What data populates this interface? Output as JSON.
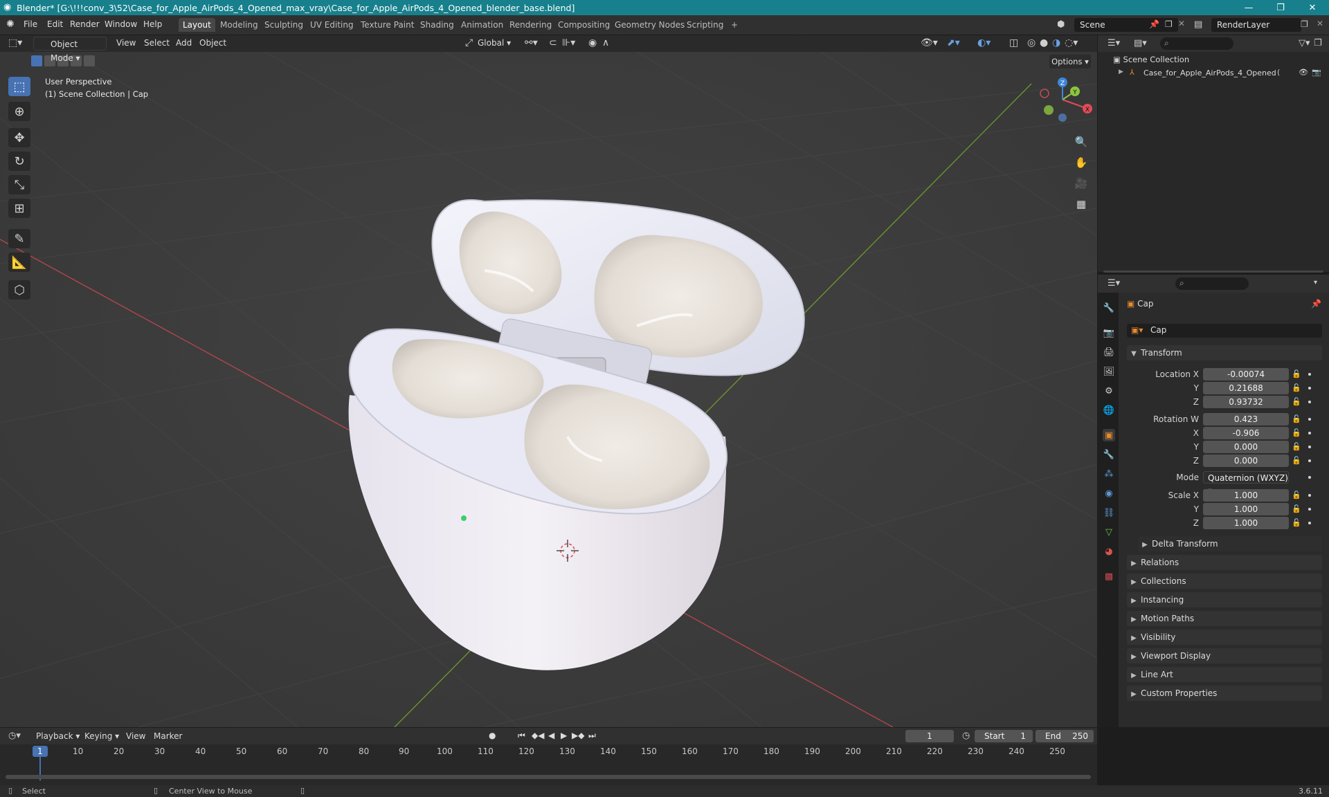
{
  "window": {
    "title": "Blender* [G:\\!!!conv_3\\52\\Case_for_Apple_AirPods_4_Opened_max_vray\\Case_for_Apple_AirPods_4_Opened_blender_base.blend]",
    "minimize": "—",
    "maximize": "❐",
    "close": "✕"
  },
  "menubar": {
    "items": [
      "File",
      "Edit",
      "Render",
      "Window",
      "Help"
    ]
  },
  "workspaces": [
    "Layout",
    "Modeling",
    "Sculpting",
    "UV Editing",
    "Texture Paint",
    "Shading",
    "Animation",
    "Rendering",
    "Compositing",
    "Geometry Nodes",
    "Scripting"
  ],
  "add_workspace": "+",
  "scene": {
    "name": "Scene",
    "render_layer": "RenderLayer"
  },
  "viewport": {
    "mode": "Object Mode",
    "menus": [
      "View",
      "Select",
      "Add",
      "Object"
    ],
    "transform_orientation": "Global",
    "options_label": "Options",
    "overlay_line1": "User Perspective",
    "overlay_line2": "(1) Scene Collection | Cap",
    "gizmo": {
      "x": "X",
      "y": "Y",
      "z": "Z"
    }
  },
  "outliner": {
    "root": "Scene Collection",
    "items": [
      {
        "name": "Case_for_Apple_AirPods_4_Opened"
      }
    ]
  },
  "properties": {
    "object_name": "Cap",
    "data_name": "Cap",
    "transform_label": "Transform",
    "location": {
      "label": "Location X",
      "x": "-0.00074",
      "y": "0.21688",
      "z": "0.93732"
    },
    "rotation": {
      "label": "Rotation W",
      "w": "0.423",
      "x": "-0.906",
      "y": "0.000",
      "z": "0.000"
    },
    "mode": {
      "label": "Mode",
      "value": "Quaternion (WXYZ)"
    },
    "scale": {
      "label": "Scale X",
      "x": "1.000",
      "y": "1.000",
      "z": "1.000"
    },
    "axis_labels": {
      "x": "X",
      "y": "Y",
      "z": "Z"
    },
    "delta_transform": "Delta Transform",
    "panels": [
      "Relations",
      "Collections",
      "Instancing",
      "Motion Paths",
      "Visibility",
      "Viewport Display",
      "Line Art",
      "Custom Properties"
    ]
  },
  "timeline": {
    "menus": [
      "Playback",
      "Keying",
      "View",
      "Marker"
    ],
    "current_frame": "1",
    "start_label": "Start",
    "start": "1",
    "end_label": "End",
    "end": "250",
    "ruler": [
      "1",
      "10",
      "20",
      "30",
      "40",
      "50",
      "60",
      "70",
      "80",
      "90",
      "100",
      "110",
      "120",
      "130",
      "140",
      "150",
      "160",
      "170",
      "180",
      "190",
      "200",
      "210",
      "220",
      "230",
      "240",
      "250"
    ]
  },
  "statusbar": {
    "left": "Select",
    "middle": "Center View to Mouse",
    "version": "3.6.11"
  },
  "colors": {
    "accent": "#4772b3",
    "titlebar": "#17808c",
    "x_axis": "#e14b57",
    "y_axis": "#8cc63f",
    "z_axis": "#3d86d8",
    "orange": "#e68a2e"
  }
}
